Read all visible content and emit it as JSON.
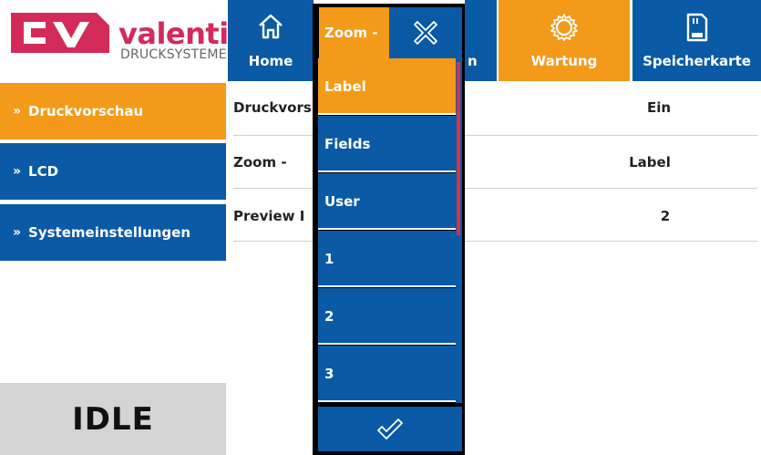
{
  "logo": {
    "brand": "valentin",
    "sub": "DRUCKSYSTEME"
  },
  "nav": {
    "home_label": "Home",
    "hidden_label_fragment": "n",
    "wartung_label": "Wartung",
    "speicherkarte_label": "Speicherkarte"
  },
  "sidebar": {
    "items": [
      {
        "label": "Druckvorschau"
      },
      {
        "label": "LCD"
      },
      {
        "label": "Systemeinstellungen"
      }
    ]
  },
  "status": "IDLE",
  "settings": {
    "rows": [
      {
        "label": "Druckvors",
        "value": "Ein"
      },
      {
        "label": "Zoom -",
        "value": "Label"
      },
      {
        "label": "Preview I",
        "value": "2"
      }
    ]
  },
  "dropdown": {
    "title": "Zoom -",
    "options": [
      "Label",
      "Fields",
      "User",
      "1",
      "2",
      "3"
    ],
    "selected_index": 0
  },
  "colors": {
    "accent_orange": "#f39a1a",
    "primary_blue": "#0b5aa5",
    "scroll_red": "#d6334a"
  }
}
